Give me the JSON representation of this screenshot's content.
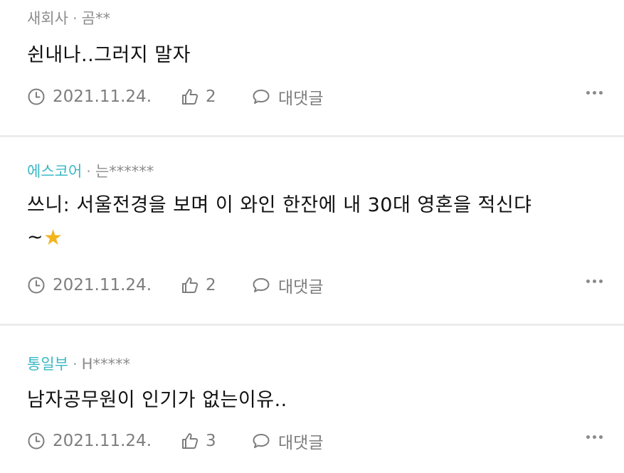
{
  "comments": [
    {
      "board": "새회사",
      "nickname": "곰**",
      "text": "쉰내나..그러지 말자",
      "date": "2021.11.24.",
      "likes": "2",
      "reply_label": "대댓글"
    },
    {
      "board": "에스코어",
      "nickname": "는******",
      "text": "쓰니: 서울전경을 보며 이 와인 한잔에 내 30대 영혼을 적신댜",
      "text_line2": "~",
      "date": "2021.11.24.",
      "likes": "2",
      "reply_label": "대댓글"
    },
    {
      "board": "통일부",
      "nickname": "H*****",
      "text": "남자공무원이 인기가 없는이유..",
      "date": "2021.11.24.",
      "likes": "3",
      "reply_label": "대댓글"
    }
  ],
  "separator": "·",
  "colors": {
    "board_teal": "#3ab8c4",
    "meta_gray": "#8c8c8c",
    "star": "#f2b51f"
  },
  "icons": [
    "clock-icon",
    "thumbs-up-icon",
    "speech-bubble-icon",
    "more-dots-icon",
    "star-icon"
  ]
}
